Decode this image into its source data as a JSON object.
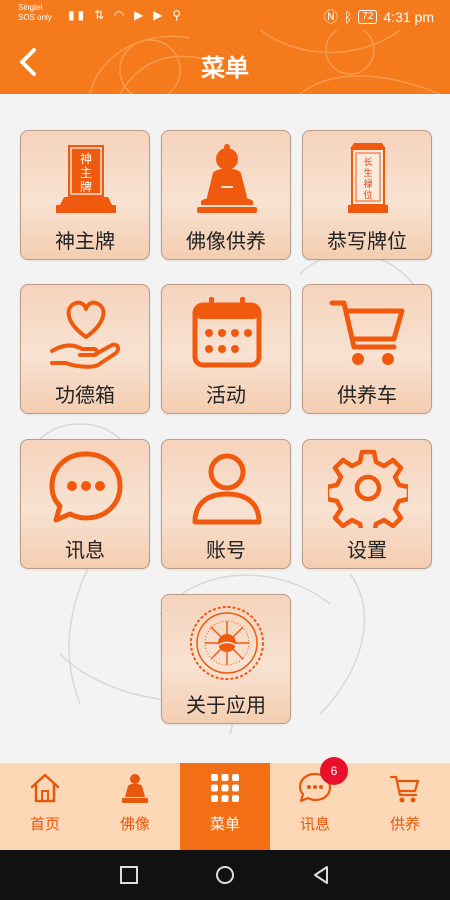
{
  "status_bar": {
    "carrier_line1": "Singtel",
    "carrier_line2": "SOS only",
    "left_icons": "▮▮ ⇅ ◠ ▶ ▶ ⚲",
    "battery": "72",
    "time": "4:31 pm"
  },
  "header": {
    "title": "菜单",
    "back_icon": "chevron-left-icon"
  },
  "menu": {
    "items": [
      {
        "label": "神主牌",
        "icon": "ancestral-tablet-icon",
        "icon_text": "神主牌"
      },
      {
        "label": "佛像供养",
        "icon": "buddha-statue-icon"
      },
      {
        "label": "恭写牌位",
        "icon": "memorial-plaque-icon",
        "icon_text": "长生禄位"
      },
      {
        "label": "功德箱",
        "icon": "heart-hand-icon"
      },
      {
        "label": "活动",
        "icon": "calendar-icon"
      },
      {
        "label": "供养车",
        "icon": "shopping-cart-icon"
      },
      {
        "label": "讯息",
        "icon": "chat-bubble-icon"
      },
      {
        "label": "账号",
        "icon": "user-icon"
      },
      {
        "label": "设置",
        "icon": "gear-icon"
      },
      {
        "label": "关于应用",
        "icon": "dharma-emblem-icon"
      }
    ]
  },
  "bottom_nav": {
    "items": [
      {
        "label": "首页",
        "icon": "home-icon"
      },
      {
        "label": "佛像",
        "icon": "buddha-icon"
      },
      {
        "label": "菜单",
        "icon": "grid-menu-icon",
        "active": true
      },
      {
        "label": "讯息",
        "icon": "chat-icon",
        "badge": "6"
      },
      {
        "label": "供养",
        "icon": "cart-icon"
      }
    ]
  },
  "colors": {
    "primary": "#f47a1c",
    "nav_background": "#fcd8b6",
    "active_tab": "#f26f16",
    "icon_orange": "#e8580c",
    "badge": "#e8102a"
  }
}
